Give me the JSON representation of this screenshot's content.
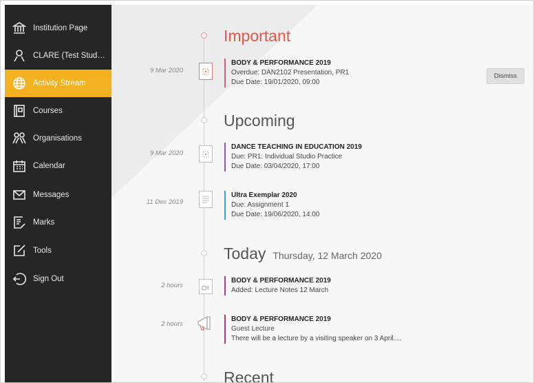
{
  "sidebar": {
    "items": [
      {
        "label": "Institution Page",
        "icon": "institution-icon"
      },
      {
        "label": "CLARE (Test Studen...",
        "icon": "user-icon"
      },
      {
        "label": "Activity Stream",
        "icon": "globe-icon",
        "active": true
      },
      {
        "label": "Courses",
        "icon": "courses-icon"
      },
      {
        "label": "Organisations",
        "icon": "organisations-icon"
      },
      {
        "label": "Calendar",
        "icon": "calendar-icon"
      },
      {
        "label": "Messages",
        "icon": "envelope-icon"
      },
      {
        "label": "Marks",
        "icon": "marks-icon"
      },
      {
        "label": "Tools",
        "icon": "tools-icon"
      },
      {
        "label": "Sign Out",
        "icon": "sign-out-icon"
      }
    ],
    "active_color": "#f3b021"
  },
  "stream": {
    "important": {
      "title": "Important",
      "entries": [
        {
          "date": "9 Mar 2020",
          "course": "BODY & PERFORMANCE 2019",
          "line1": "Overdue: DAN2102 Presentation, PR1",
          "line2": "Due Date: 19/01/2020, 09:00",
          "action": "Dismiss"
        }
      ]
    },
    "upcoming": {
      "title": "Upcoming",
      "entries": [
        {
          "date": "9 Mar 2020",
          "course": "DANCE TEACHING IN EDUCATION 2019",
          "line1": "Due: PR1: Individual Studio Practice",
          "line2": "Due Date: 03/04/2020, 17:00"
        },
        {
          "date": "11 Dec 2019",
          "course": "Ultra Exemplar 2020",
          "line1": "Due: Assignment 1",
          "line2": "Due Date: 19/06/2020, 14:00"
        }
      ]
    },
    "today": {
      "title": "Today",
      "subtitle": "Thursday, 12 March 2020",
      "entries": [
        {
          "date": "2 hours",
          "course": "BODY & PERFORMANCE 2019",
          "line1": "Added: Lecture Notes 12 March"
        },
        {
          "date": "2 hours",
          "course": "BODY & PERFORMANCE 2019",
          "line1": "Guest Lecture",
          "line2": "There will be a lecture by a visiting speaker on 3 April...."
        }
      ]
    },
    "recent": {
      "title": "Recent"
    }
  }
}
